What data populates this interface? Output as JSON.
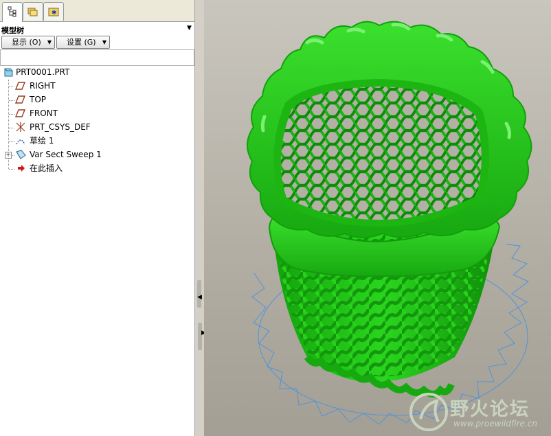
{
  "panel": {
    "title": "模型树",
    "show_button": "显示 (O)",
    "settings_button": "设置 (G)",
    "filter_value": ""
  },
  "tabs": [
    {
      "icon": "model-tree-icon",
      "active": true
    },
    {
      "icon": "folder-browser-icon",
      "active": false
    },
    {
      "icon": "favorites-folder-icon",
      "active": false
    }
  ],
  "tree": {
    "root": "PRT0001.PRT",
    "items": [
      {
        "label": "RIGHT",
        "icon": "datum-plane-icon"
      },
      {
        "label": "TOP",
        "icon": "datum-plane-icon"
      },
      {
        "label": "FRONT",
        "icon": "datum-plane-icon"
      },
      {
        "label": "PRT_CSYS_DEF",
        "icon": "csys-icon"
      },
      {
        "label": "草绘 1",
        "icon": "sketch-icon"
      },
      {
        "label": "Var Sect Sweep 1",
        "icon": "sweep-feature-icon"
      },
      {
        "label": "在此插入",
        "icon": "insert-here-arrow-icon"
      }
    ]
  },
  "watermark": {
    "title": "野火论坛",
    "url": "www.proewildfire.cn"
  },
  "colors": {
    "model": "#22c41a",
    "model_dark": "#0f7a0a",
    "sketch": "#4f94d8",
    "background": "#b8b4aa"
  }
}
